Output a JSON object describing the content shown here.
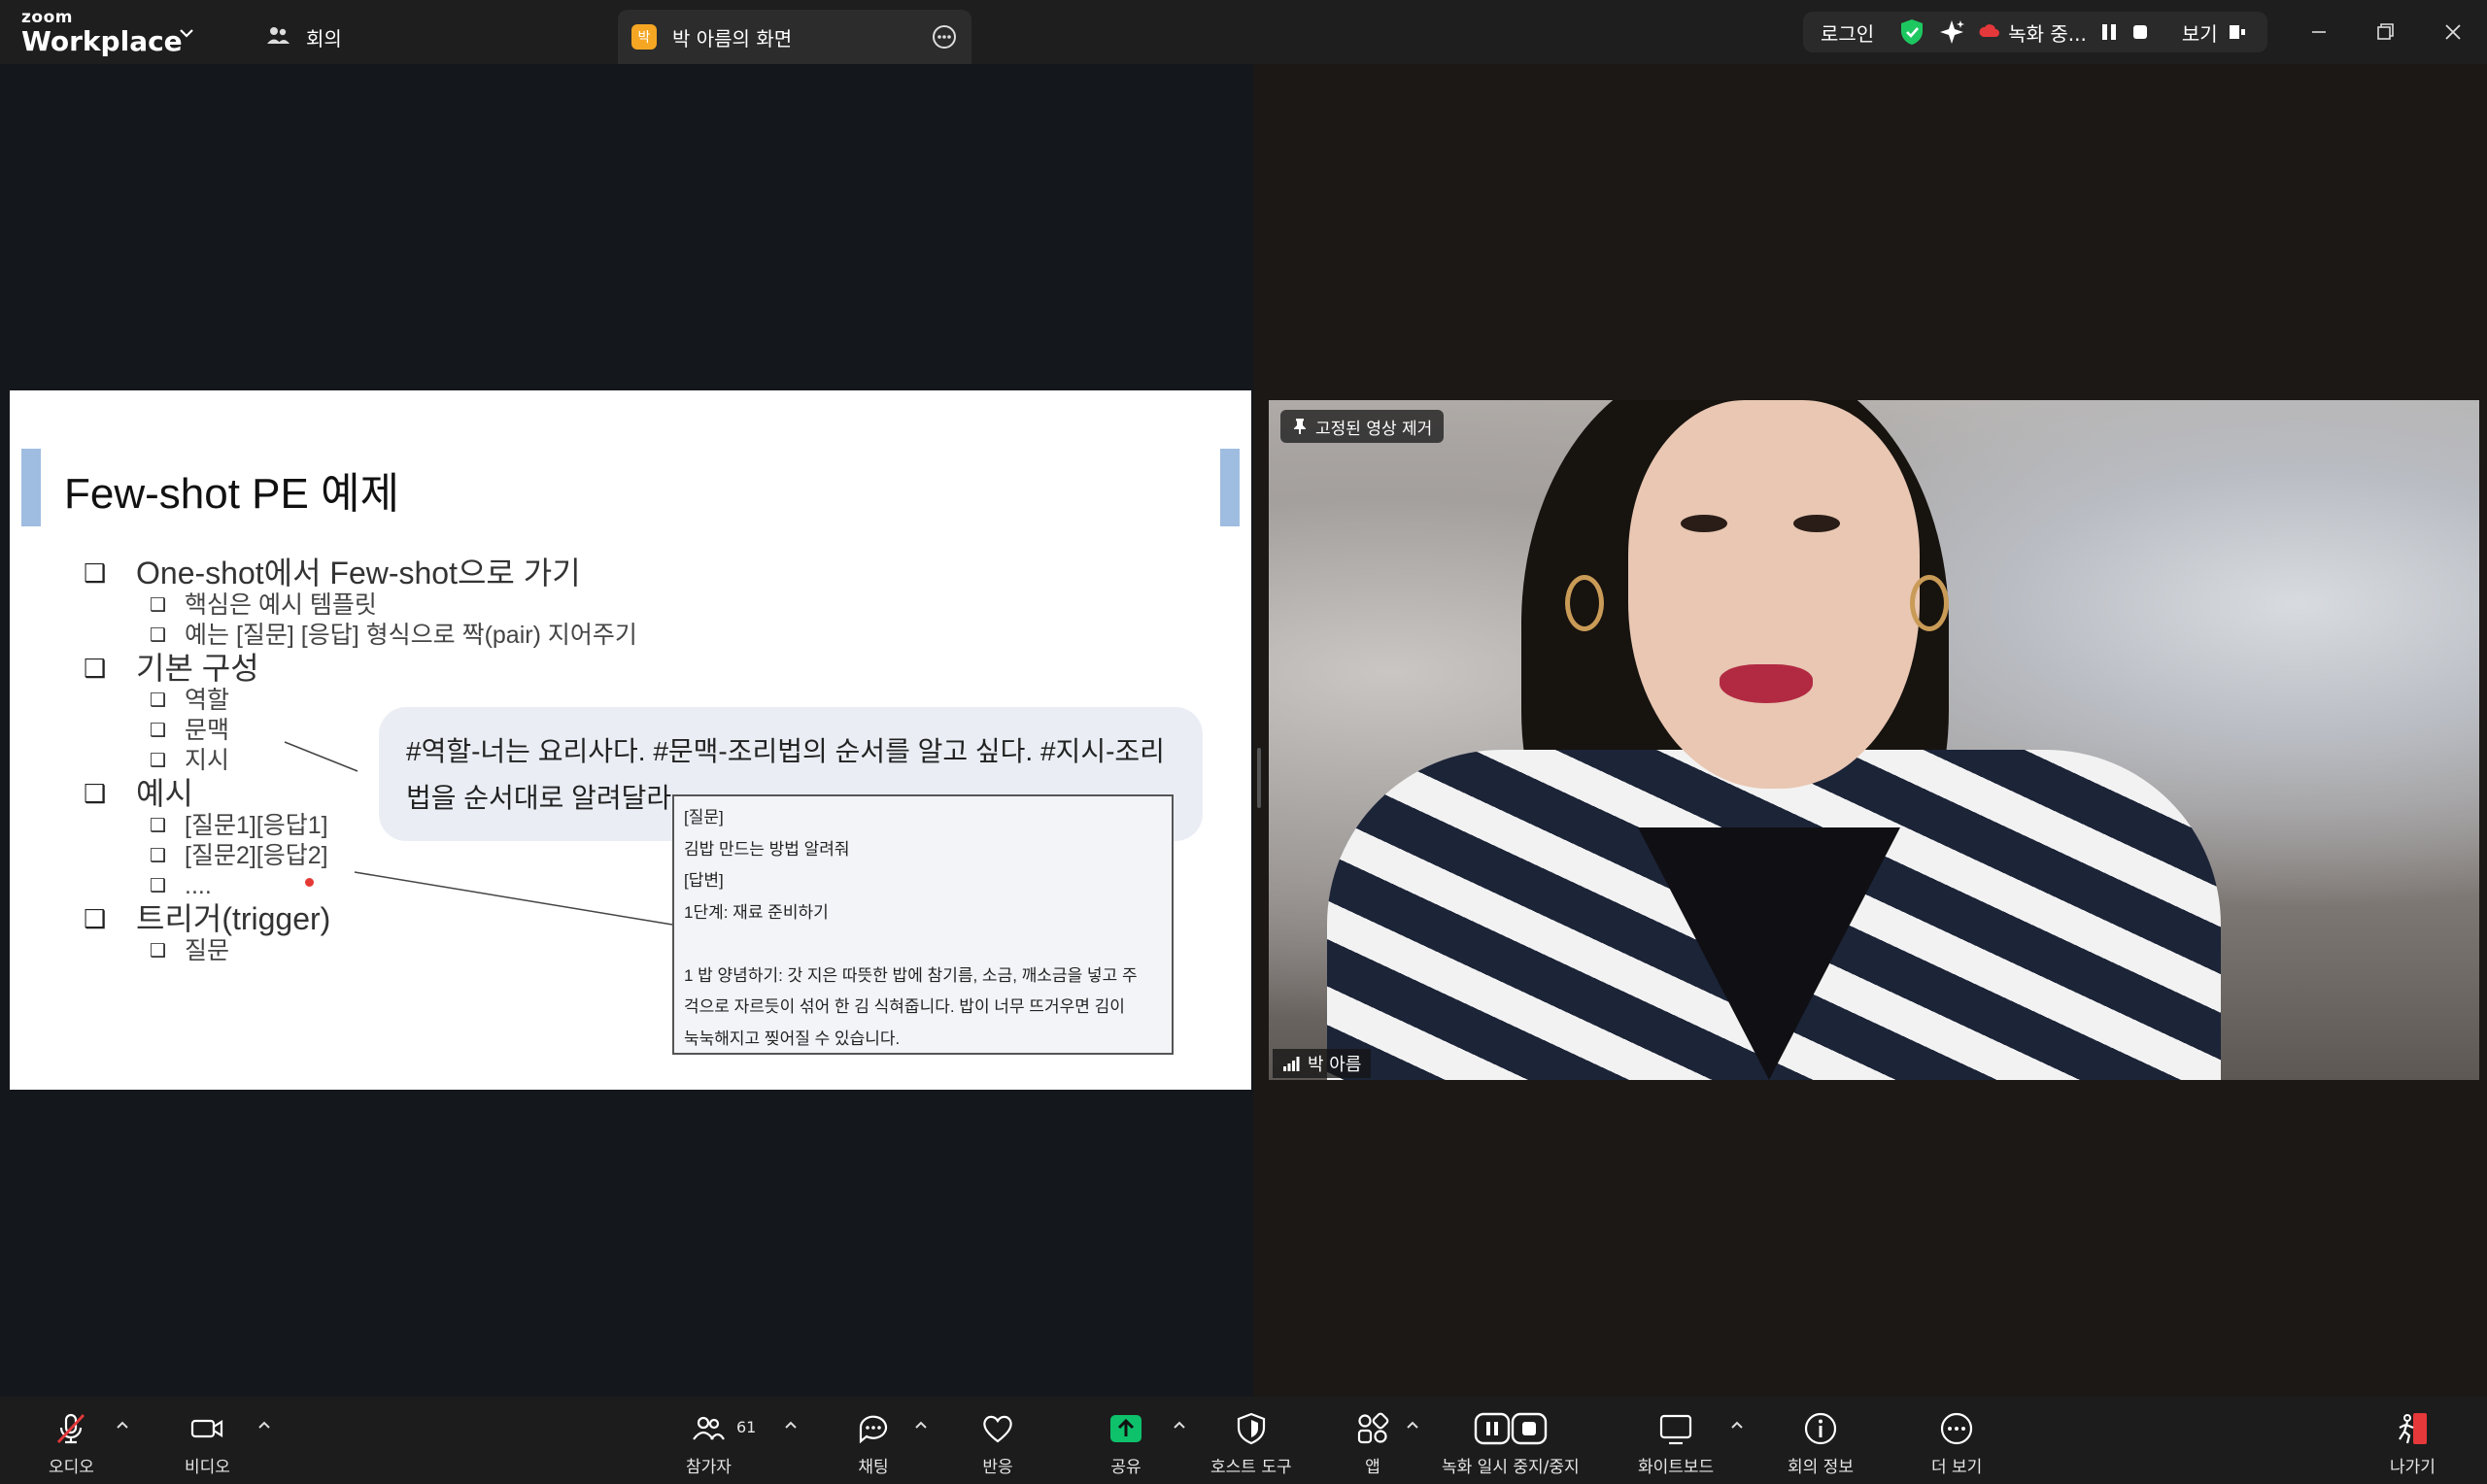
{
  "titlebar": {
    "logo_top": "zoom",
    "logo_bottom": "Workplace",
    "meeting_tab": "회의",
    "share_tab_avatar": "박",
    "share_tab": "박 아름의 화면",
    "login": "로그인",
    "recording": "녹화 중...",
    "view": "보기"
  },
  "slide": {
    "title": "Few-shot PE 예제",
    "items": [
      {
        "level": 1,
        "text": "One-shot에서 Few-shot으로 가기"
      },
      {
        "level": 2,
        "text": "핵심은 예시 템플릿"
      },
      {
        "level": 2,
        "text": "예는 [질문] [응답] 형식으로 짝(pair) 지어주기"
      },
      {
        "level": 1,
        "text": "기본 구성"
      },
      {
        "level": 2,
        "text": "역할"
      },
      {
        "level": 2,
        "text": "문맥"
      },
      {
        "level": 2,
        "text": "지시"
      },
      {
        "level": 1,
        "text": "예시"
      },
      {
        "level": 2,
        "text": "[질문1][응답1]"
      },
      {
        "level": 2,
        "text": "[질문2][응답2]"
      },
      {
        "level": 2,
        "text": "...."
      },
      {
        "level": 1,
        "text": "트리거(trigger)"
      },
      {
        "level": 2,
        "text": "질문"
      }
    ],
    "bubble": "#역할-너는 요리사다. #문맥-조리법의 순서를 알고 싶다. #지시-조리법을 순서대로 알려달라.",
    "callout": [
      "[질문]",
      "김밥 만드는 방법 알려줘",
      "[답변]",
      "1단계: 재료 준비하기",
      "",
      "1 밥 양념하기: 갓 지은 따뜻한 밥에 참기름, 소금, 깨소금을 넣고 주",
      "걱으로 자르듯이 섞어 한 김 식혀줍니다. 밥이 너무 뜨거우면 김이",
      "눅눅해지고 찢어질 수 있습니다."
    ]
  },
  "video": {
    "pin_label": "고정된 영상 제거",
    "participant_name": "박 아름"
  },
  "toolbar": {
    "audio": "오디오",
    "video": "비디오",
    "participants": "참가자",
    "participants_count": "61",
    "chat": "채팅",
    "reactions": "반응",
    "share": "공유",
    "host_tools": "호스트 도구",
    "apps": "앱",
    "recording": "녹화 일시 중지/중지",
    "whiteboard": "화이트보드",
    "meeting_info": "회의 정보",
    "more": "더 보기",
    "leave": "나가기"
  },
  "colors": {
    "share_accent": "#0ec26b",
    "shield_green": "#1ec861",
    "slide_accent_bar": "#9fbde0",
    "leave_red": "#e5383b",
    "avatar_orange": "#f5a623"
  },
  "icons": [
    "chevron-down-icon",
    "people-icon",
    "more-icon",
    "shield-check-icon",
    "sparkle-icon",
    "cloud-record-icon",
    "pause-icon",
    "stop-icon",
    "view-icon",
    "minimize-icon",
    "maximize-icon",
    "close-icon",
    "pin-icon",
    "signal-icon",
    "mic-muted-icon",
    "camera-icon",
    "chat-icon",
    "heart-icon",
    "share-up-icon",
    "host-shield-icon",
    "apps-icon",
    "record-controls-icon",
    "whiteboard-icon",
    "info-icon",
    "ellipsis-icon",
    "leave-icon"
  ]
}
